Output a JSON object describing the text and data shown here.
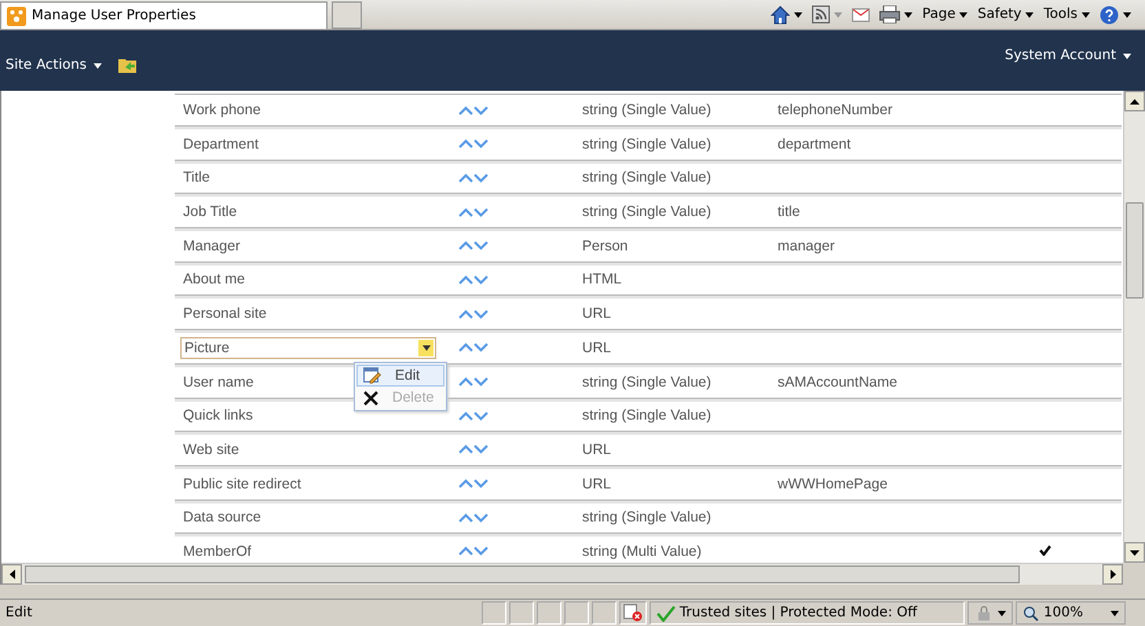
{
  "browser": {
    "tab_title": "Manage User Properties",
    "commands": [
      "Page",
      "Safety",
      "Tools"
    ]
  },
  "site_header": {
    "site_actions": "Site Actions",
    "user": "System Account"
  },
  "properties": [
    {
      "name": "Work phone",
      "type": "string (Single Value)",
      "mapping": "telephoneNumber",
      "checked": false,
      "selected": false
    },
    {
      "name": "Department",
      "type": "string (Single Value)",
      "mapping": "department",
      "checked": false,
      "selected": false
    },
    {
      "name": "Title",
      "type": "string (Single Value)",
      "checked": false,
      "selected": false
    },
    {
      "name": "Job Title",
      "type": "string (Single Value)",
      "mapping": "title",
      "checked": false,
      "selected": false
    },
    {
      "name": "Manager",
      "type": "Person",
      "mapping": "manager",
      "checked": false,
      "selected": false
    },
    {
      "name": "About me",
      "type": "HTML",
      "checked": false,
      "selected": false
    },
    {
      "name": "Personal site",
      "type": "URL",
      "checked": false,
      "selected": false
    },
    {
      "name": "Picture",
      "type": "URL",
      "checked": false,
      "selected": true
    },
    {
      "name": "User name",
      "type": "string (Single Value)",
      "mapping": "sAMAccountName",
      "checked": false,
      "selected": false
    },
    {
      "name": "Quick links",
      "type": "string (Single Value)",
      "checked": false,
      "selected": false
    },
    {
      "name": "Web site",
      "type": "URL",
      "checked": false,
      "selected": false
    },
    {
      "name": "Public site redirect",
      "type": "URL",
      "mapping": "wWWHomePage",
      "checked": false,
      "selected": false
    },
    {
      "name": "Data source",
      "type": "string (Single Value)",
      "checked": false,
      "selected": false
    },
    {
      "name": "MemberOf",
      "type": "string (Multi Value)",
      "checked": true,
      "selected": false
    }
  ],
  "context_menu": [
    {
      "label": "Edit",
      "kind": "edit",
      "disabled": false,
      "selected": true
    },
    {
      "label": "Delete",
      "kind": "delete",
      "disabled": true,
      "selected": false
    }
  ],
  "status_bar": {
    "text": "Edit",
    "zone": "Trusted sites | Protected Mode: Off",
    "zoom": "100%"
  }
}
